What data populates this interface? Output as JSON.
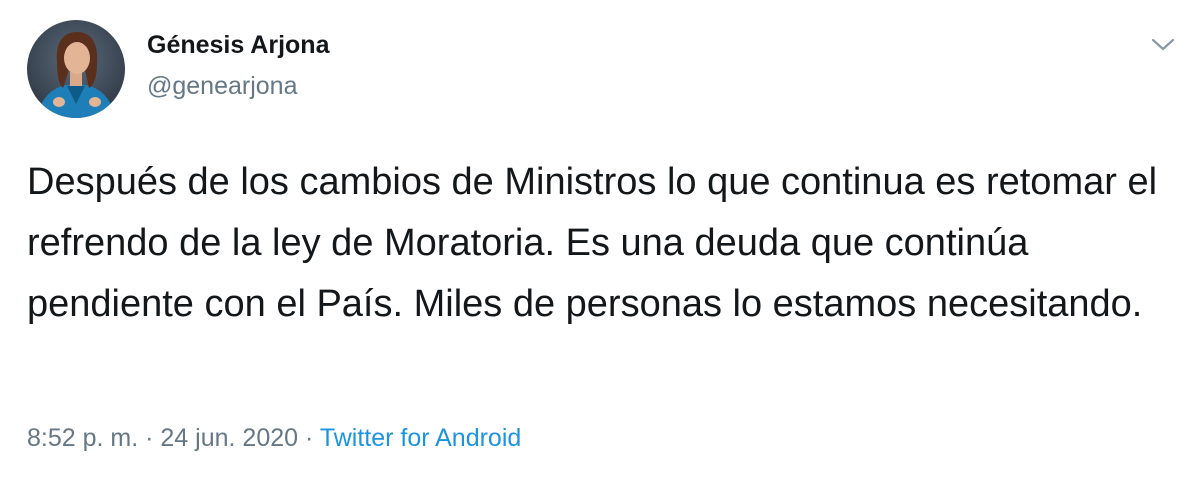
{
  "author": {
    "display_name": "Génesis Arjona",
    "handle": "@genearjona",
    "avatar_icon": "profile-photo"
  },
  "tweet": {
    "text": "Después de los cambios de Ministros lo que continua es retomar el refrendo de la ley de Moratoria. Es una deuda que continúa pendiente con el País. Miles de personas lo estamos necesitando."
  },
  "meta": {
    "time": "8:52 p. m.",
    "separator": "·",
    "date": "24 jun. 2020",
    "source": "Twitter for Android"
  },
  "menu": {
    "icon": "chevron-down-icon"
  },
  "colors": {
    "text": "#14171a",
    "secondary": "#657786",
    "link": "#1b95e0",
    "background": "#ffffff"
  }
}
